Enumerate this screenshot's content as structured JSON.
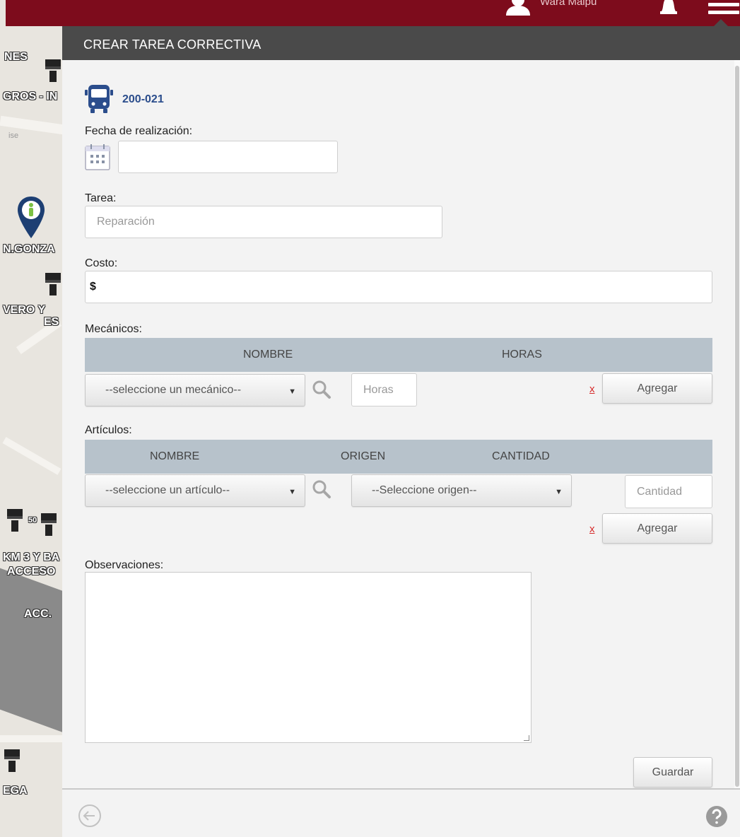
{
  "topbar": {
    "user_name": "Wara Maipu",
    "user_icon": "person-icon",
    "notification_icon": "bell-icon",
    "menu_icon": "hamburger-menu-icon"
  },
  "map": {
    "labels": [
      "NES",
      "GROS - IN",
      "N.GONZA",
      "VERO Y",
      "ES",
      "KM 3 Y BA",
      "ACCESO",
      "ACC.",
      "EGA",
      "50"
    ],
    "street_label": "ise"
  },
  "panel": {
    "title": "CREAR TAREA CORRECTIVA",
    "vehicle_icon": "bus-icon",
    "vehicle_code": "200-021",
    "fecha": {
      "label": "Fecha de realización:",
      "value": ""
    },
    "tarea": {
      "label": "Tarea:",
      "placeholder": "Reparación"
    },
    "costo": {
      "label": "Costo:",
      "value": "$"
    },
    "mecanicos": {
      "label": "Mecánicos:",
      "columns": [
        "NOMBRE",
        "HORAS"
      ],
      "select_placeholder": "--seleccione un mecánico--",
      "horas_placeholder": "Horas",
      "remove_label": "x",
      "add_label": "Agregar"
    },
    "articulos": {
      "label": "Artículos:",
      "columns": [
        "NOMBRE",
        "ORIGEN",
        "CANTIDAD"
      ],
      "select_placeholder": "--seleccione un artículo--",
      "origen_placeholder": "--Seleccione origen--",
      "cantidad_placeholder": "Cantidad",
      "remove_label": "x",
      "add_label": "Agregar"
    },
    "observaciones": {
      "label": "Observaciones:",
      "value": ""
    },
    "save_label": "Guardar",
    "footer": {
      "back_icon": "back-arrow-icon",
      "help_icon": "help-icon"
    }
  },
  "colors": {
    "topbar": "#7d0c1c",
    "panel_header": "#4a4a4a",
    "grid_header": "#b7c2cb",
    "vehicle_code": "#2b4d8c",
    "remove_link": "#d62a2a"
  }
}
